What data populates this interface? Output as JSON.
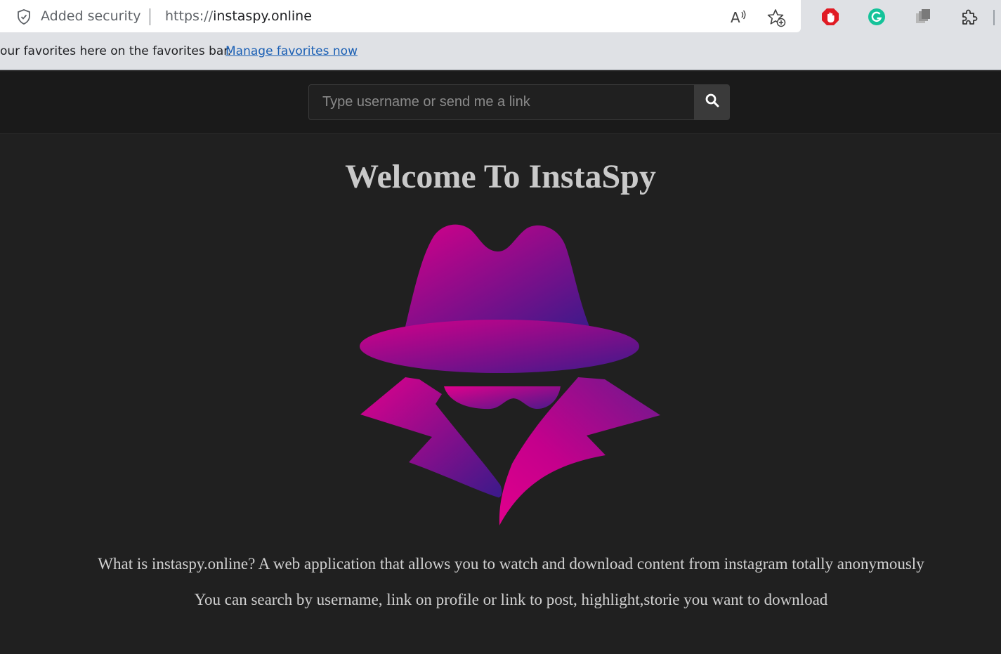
{
  "browser": {
    "security_label": "Added security",
    "url_scheme": "https://",
    "url_host": "instaspy.online",
    "favorites_bar_text": "our favorites here on the favorites bar.",
    "favorites_link": "Manage favorites now",
    "icons": [
      "shield-icon",
      "read-aloud-icon",
      "add-favorite-icon",
      "adblock-extension-icon",
      "grammarly-extension-icon",
      "collections-extension-icon",
      "extensions-puzzle-icon"
    ]
  },
  "header": {
    "search_placeholder": "Type username or send me a link",
    "search_icon": "search-icon"
  },
  "main": {
    "title": "Welcome To InstaSpy",
    "logo": "spy-logo",
    "description_1": "What is instaspy.online? A web application that allows you to watch and download content from instagram totally anonymously",
    "description_2": "You can search by username, link on profile or link to post, highlight,storie you want to download"
  },
  "colors": {
    "page_bg": "#202020",
    "header_bg": "#1a1a1a",
    "logo_gradient_start": "#d4008a",
    "logo_gradient_end": "#3d1a8a",
    "link": "#1a5fb4"
  }
}
